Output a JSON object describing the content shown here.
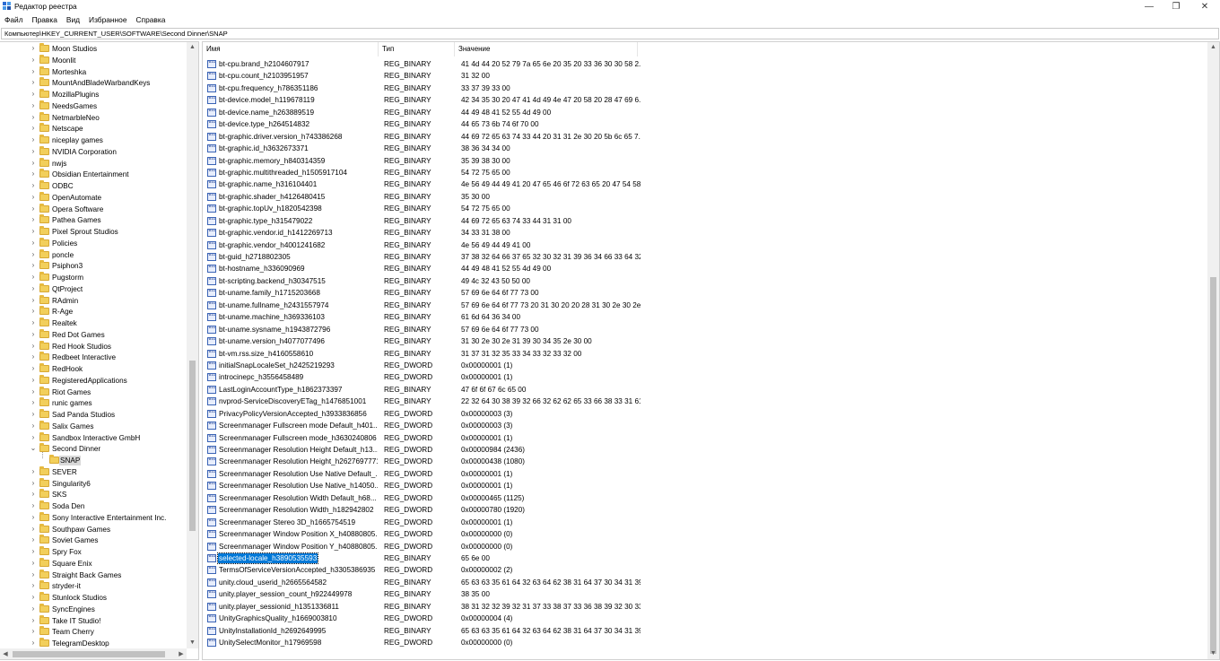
{
  "window": {
    "title": "Редактор реестра",
    "controls": {
      "minimize": "—",
      "maximize": "❐",
      "close": "✕"
    }
  },
  "menu": [
    {
      "label": "Файл"
    },
    {
      "label": "Правка"
    },
    {
      "label": "Вид"
    },
    {
      "label": "Избранное"
    },
    {
      "label": "Справка"
    }
  ],
  "address": "Компьютер\\HKEY_CURRENT_USER\\SOFTWARE\\Second Dinner\\SNAP",
  "tree": {
    "items": [
      "Moon Studios",
      "Moonlit",
      "Morteshka",
      "MountAndBladeWarbandKeys",
      "MozillaPlugins",
      "NeedsGames",
      "NetmarbleNeo",
      "Netscape",
      "niceplay games",
      "NVIDIA Corporation",
      "nwjs",
      "Obsidian Entertainment",
      "ODBC",
      "OpenAutomate",
      "Opera Software",
      "Pathea Games",
      "Pixel Sprout Studios",
      "Policies",
      "poncle",
      "Psiphon3",
      "Pugstorm",
      "QtProject",
      "RAdmin",
      "R-Age",
      "Realtek",
      "Red Dot Games",
      "Red Hook Studios",
      "Redbeet Interactive",
      "RedHook",
      "RegisteredApplications",
      "Riot Games",
      "runic games",
      "Sad Panda Studios",
      "Salix Games",
      "Sandbox Interactive GmbH",
      "Second Dinner",
      "SNAP",
      "SEVER",
      "Singularity6",
      "SKS",
      "Soda Den",
      "Sony Interactive Entertainment Inc.",
      "Southpaw Games",
      "Soviet Games",
      "Spry Fox",
      "Square Enix",
      "Straight Back Games",
      "stryder-it",
      "Stunlock Studios",
      "SyncEngines",
      "Take IT Studio!",
      "Team Cherry",
      "TelegramDesktop"
    ]
  },
  "list": {
    "columns": {
      "name": "Имя",
      "type": "Тип",
      "value": "Значение"
    },
    "rows": [
      {
        "name": "bt-cpu.brand_h2104607917",
        "type": "REG_BINARY",
        "value": "41 4d 44 20 52 79 7a 65 6e 20 35 20 33 36 30 30 58 2..."
      },
      {
        "name": "bt-cpu.count_h2103951957",
        "type": "REG_BINARY",
        "value": "31 32 00"
      },
      {
        "name": "bt-cpu.frequency_h786351186",
        "type": "REG_BINARY",
        "value": "33 37 39 33 00"
      },
      {
        "name": "bt-device.model_h119678119",
        "type": "REG_BINARY",
        "value": "42 34 35 30 20 47 41 4d 49 4e 47 20 58 20 28 47 69 6..."
      },
      {
        "name": "bt-device.name_h263889519",
        "type": "REG_BINARY",
        "value": "44 49 48 41 52 55 4d 49 00"
      },
      {
        "name": "bt-device.type_h264514832",
        "type": "REG_BINARY",
        "value": "44 65 73 6b 74 6f 70 00"
      },
      {
        "name": "bt-graphic.driver.version_h743386268",
        "type": "REG_BINARY",
        "value": "44 69 72 65 63 74 33 44 20 31 31 2e 30 20 5b 6c 65 7..."
      },
      {
        "name": "bt-graphic.id_h3632673371",
        "type": "REG_BINARY",
        "value": "38 36 34 34 00"
      },
      {
        "name": "bt-graphic.memory_h840314359",
        "type": "REG_BINARY",
        "value": "35 39 38 30 00"
      },
      {
        "name": "bt-graphic.multithreaded_h1505917104",
        "type": "REG_BINARY",
        "value": "54 72 75 65 00"
      },
      {
        "name": "bt-graphic.name_h316104401",
        "type": "REG_BINARY",
        "value": "4e 56 49 44 49 41 20 47 65 46 6f 72 63 65 20 47 54 58..."
      },
      {
        "name": "bt-graphic.shader_h4126480415",
        "type": "REG_BINARY",
        "value": "35 30 00"
      },
      {
        "name": "bt-graphic.topUv_h1820542398",
        "type": "REG_BINARY",
        "value": "54 72 75 65 00"
      },
      {
        "name": "bt-graphic.type_h315479022",
        "type": "REG_BINARY",
        "value": "44 69 72 65 63 74 33 44 31 31 00"
      },
      {
        "name": "bt-graphic.vendor.id_h1412269713",
        "type": "REG_BINARY",
        "value": "34 33 31 38 00"
      },
      {
        "name": "bt-graphic.vendor_h4001241682",
        "type": "REG_BINARY",
        "value": "4e 56 49 44 49 41 00"
      },
      {
        "name": "bt-guid_h2718802305",
        "type": "REG_BINARY",
        "value": "37 38 32 64 66 37 65 32 30 32 31 39 36 34 66 33 64 32..."
      },
      {
        "name": "bt-hostname_h336090969",
        "type": "REG_BINARY",
        "value": "44 49 48 41 52 55 4d 49 00"
      },
      {
        "name": "bt-scripting.backend_h30347515",
        "type": "REG_BINARY",
        "value": "49 4c 32 43 50 50 00"
      },
      {
        "name": "bt-uname.family_h1715203668",
        "type": "REG_BINARY",
        "value": "57 69 6e 64 6f 77 73 00"
      },
      {
        "name": "bt-uname.fullname_h2431557974",
        "type": "REG_BINARY",
        "value": "57 69 6e 64 6f 77 73 20 31 30 20 20 28 31 30 2e 30 2e..."
      },
      {
        "name": "bt-uname.machine_h369336103",
        "type": "REG_BINARY",
        "value": "61 6d 64 36 34 00"
      },
      {
        "name": "bt-uname.sysname_h1943872796",
        "type": "REG_BINARY",
        "value": "57 69 6e 64 6f 77 73 00"
      },
      {
        "name": "bt-uname.version_h4077077496",
        "type": "REG_BINARY",
        "value": "31 30 2e 30 2e 31 39 30 34 35 2e 30 00"
      },
      {
        "name": "bt-vm.rss.size_h4160558610",
        "type": "REG_BINARY",
        "value": "31 37 31 32 35 33 34 33 32 33 32 00"
      },
      {
        "name": "initialSnapLocaleSet_h2425219293",
        "type": "REG_DWORD",
        "value": "0x00000001 (1)"
      },
      {
        "name": "introcinepc_h3556458489",
        "type": "REG_DWORD",
        "value": "0x00000001 (1)"
      },
      {
        "name": "LastLoginAccountType_h1862373397",
        "type": "REG_BINARY",
        "value": "47 6f 6f 67 6c 65 00"
      },
      {
        "name": "nvprod-ServiceDiscoveryETag_h1476851001",
        "type": "REG_BINARY",
        "value": "22 32 64 30 38 39 32 66 32 62 62 65 33 66 38 33 31 61..."
      },
      {
        "name": "PrivacyPolicyVersionAccepted_h3933836856",
        "type": "REG_DWORD",
        "value": "0x00000003 (3)"
      },
      {
        "name": "Screenmanager Fullscreen mode Default_h401...",
        "type": "REG_DWORD",
        "value": "0x00000003 (3)"
      },
      {
        "name": "Screenmanager Fullscreen mode_h3630240806",
        "type": "REG_DWORD",
        "value": "0x00000001 (1)"
      },
      {
        "name": "Screenmanager Resolution Height Default_h13...",
        "type": "REG_DWORD",
        "value": "0x00000984 (2436)"
      },
      {
        "name": "Screenmanager Resolution Height_h2627697771",
        "type": "REG_DWORD",
        "value": "0x00000438 (1080)"
      },
      {
        "name": "Screenmanager Resolution Use Native Default_...",
        "type": "REG_DWORD",
        "value": "0x00000001 (1)"
      },
      {
        "name": "Screenmanager Resolution Use Native_h14050...",
        "type": "REG_DWORD",
        "value": "0x00000001 (1)"
      },
      {
        "name": "Screenmanager Resolution Width Default_h68...",
        "type": "REG_DWORD",
        "value": "0x00000465 (1125)"
      },
      {
        "name": "Screenmanager Resolution Width_h182942802",
        "type": "REG_DWORD",
        "value": "0x00000780 (1920)"
      },
      {
        "name": "Screenmanager Stereo 3D_h1665754519",
        "type": "REG_DWORD",
        "value": "0x00000001 (1)"
      },
      {
        "name": "Screenmanager Window Position X_h40880805...",
        "type": "REG_DWORD",
        "value": "0x00000000 (0)"
      },
      {
        "name": "Screenmanager Window Position Y_h40880805...",
        "type": "REG_DWORD",
        "value": "0x00000000 (0)"
      },
      {
        "name": "selected-locale_h3890535593",
        "type": "REG_BINARY",
        "value": "65 6e 00",
        "selected": true
      },
      {
        "name": "TermsOfServiceVersionAccepted_h3305386935",
        "type": "REG_DWORD",
        "value": "0x00000002 (2)"
      },
      {
        "name": "unity.cloud_userid_h2665564582",
        "type": "REG_BINARY",
        "value": "65 63 63 35 61 64 32 63 64 62 38 31 64 37 30 34 31 39..."
      },
      {
        "name": "unity.player_session_count_h922449978",
        "type": "REG_BINARY",
        "value": "38 35 00"
      },
      {
        "name": "unity.player_sessionid_h1351336811",
        "type": "REG_BINARY",
        "value": "38 31 32 32 39 32 31 37 33 38 37 33 36 38 39 32 30 33..."
      },
      {
        "name": "UnityGraphicsQuality_h1669003810",
        "type": "REG_DWORD",
        "value": "0x00000004 (4)"
      },
      {
        "name": "UnityInstallationId_h2692649995",
        "type": "REG_BINARY",
        "value": "65 63 63 35 61 64 32 63 64 62 38 31 64 37 30 34 31 39..."
      },
      {
        "name": "UnitySelectMonitor_h17969598",
        "type": "REG_DWORD",
        "value": "0x00000000 (0)"
      }
    ]
  },
  "icons": {
    "app": "registry-editor-icon",
    "folder": "folder-icon",
    "value": "binary-value-icon"
  },
  "colors": {
    "selection": "#0078d7",
    "folder": "#f2cf5b",
    "tree_selection": "#d9d9d9"
  }
}
